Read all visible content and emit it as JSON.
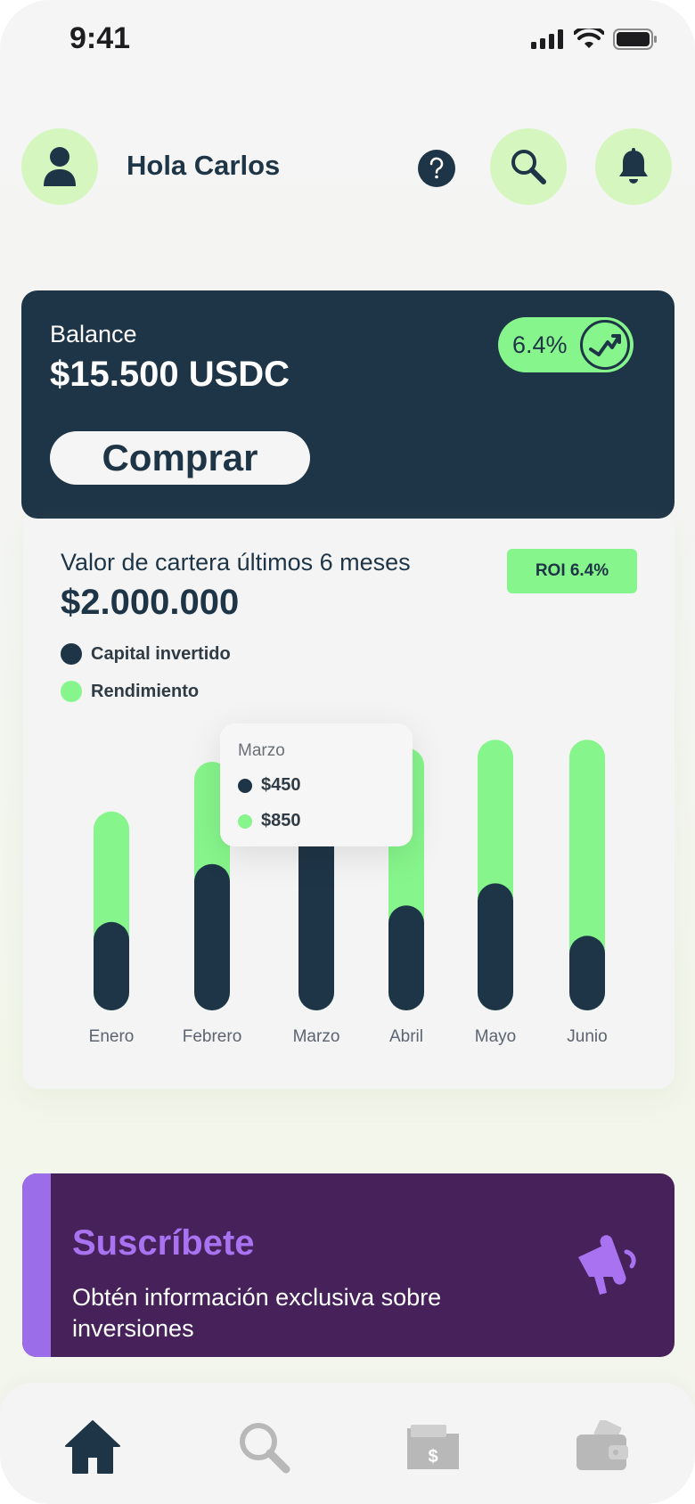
{
  "status_bar": {
    "time": "9:41"
  },
  "header": {
    "greeting": "Hola Carlos"
  },
  "balance": {
    "label": "Balance",
    "value": "$15.500 USDC",
    "buy_label": "Comprar",
    "change": "6.4%"
  },
  "portfolio": {
    "title": "Valor de cartera últimos 6 meses",
    "value": "$2.000.000",
    "roi": "ROI 6.4%",
    "legend": [
      {
        "label": "Capital invertido",
        "color": "#1e3547"
      },
      {
        "label": "Rendimiento",
        "color": "#86f58b"
      }
    ],
    "tooltip": {
      "month": "Marzo",
      "capital": "$450",
      "rendimiento": "$850"
    }
  },
  "chart_data": {
    "type": "bar",
    "stacked": true,
    "categories": [
      "Enero",
      "Febrero",
      "Marzo",
      "Abril",
      "Mayo",
      "Junio"
    ],
    "series": [
      {
        "name": "Capital invertido",
        "values": [
          0.32,
          0.53,
          0.72,
          0.38,
          0.46,
          0.27
        ],
        "color": "#1e3547"
      },
      {
        "name": "Rendimiento",
        "values": [
          0.4,
          0.37,
          0.2,
          0.57,
          0.52,
          0.71
        ],
        "color": "#86f58b"
      }
    ],
    "ylim": [
      0,
      1
    ],
    "grid": false
  },
  "subscribe": {
    "title": "Suscríbete",
    "text": "Obtén información exclusiva sobre inversiones"
  },
  "nav": {
    "items": [
      "home-icon",
      "search-icon",
      "folder-dollar-icon",
      "wallet-icon"
    ],
    "active": "home-icon",
    "active_color": "#1e3547",
    "inactive_color": "#b8b8b8"
  }
}
